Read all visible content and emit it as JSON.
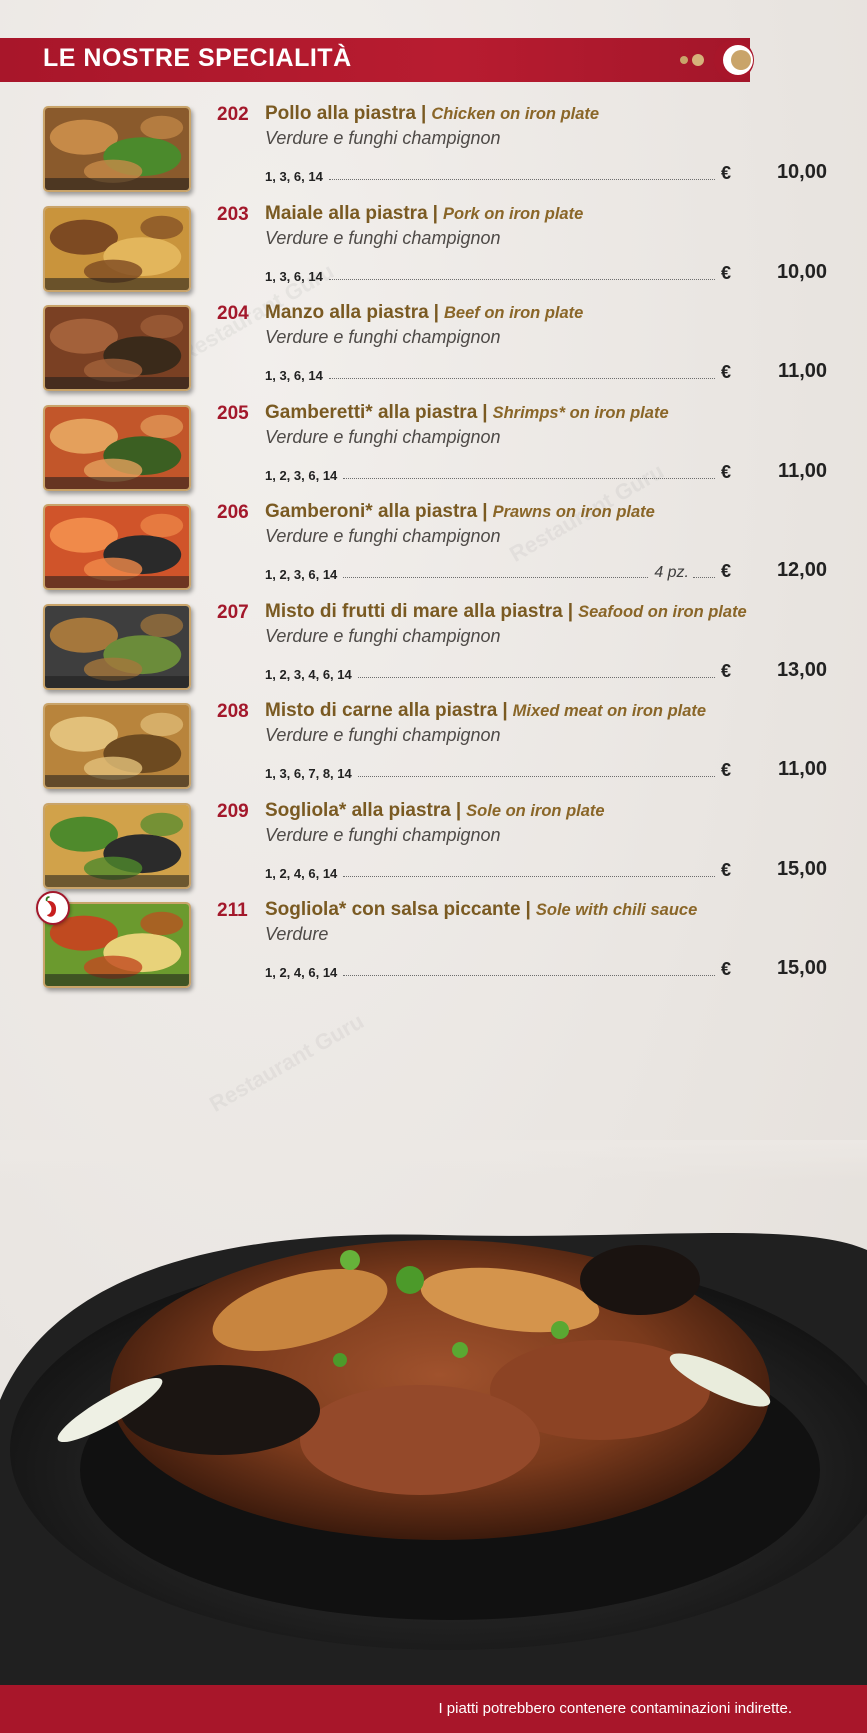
{
  "header": {
    "title": "LE NOSTRE SPECIALITÀ"
  },
  "items": [
    {
      "num": "202",
      "name_it": "Pollo alla piastra",
      "name_en": "Chicken on iron plate",
      "desc": "Verdure e funghi champignon",
      "allergens": "1, 3, 6, 14",
      "qty": "",
      "price": "10,00"
    },
    {
      "num": "203",
      "name_it": "Maiale alla piastra",
      "name_en": "Pork on iron plate",
      "desc": "Verdure e funghi champignon",
      "allergens": "1, 3, 6, 14",
      "qty": "",
      "price": "10,00"
    },
    {
      "num": "204",
      "name_it": "Manzo alla piastra",
      "name_en": "Beef on iron plate",
      "desc": "Verdure e funghi champignon",
      "allergens": "1, 3, 6, 14",
      "qty": "",
      "price": "11,00"
    },
    {
      "num": "205",
      "name_it": "Gamberetti* alla piastra",
      "name_en": "Shrimps* on iron plate",
      "desc": "Verdure e funghi champignon",
      "allergens": "1, 2, 3, 6, 14",
      "qty": "",
      "price": "11,00"
    },
    {
      "num": "206",
      "name_it": "Gamberoni* alla piastra",
      "name_en": "Prawns on iron plate",
      "desc": "Verdure e funghi champignon",
      "allergens": "1, 2, 3, 6, 14",
      "qty": "4 pz.",
      "price": "12,00"
    },
    {
      "num": "207",
      "name_it": "Misto di frutti di mare alla piastra",
      "name_en": "Seafood on iron plate",
      "desc": "Verdure e funghi champignon",
      "allergens": "1, 2, 3, 4, 6, 14",
      "qty": "",
      "price": "13,00"
    },
    {
      "num": "208",
      "name_it": "Misto di carne alla piastra",
      "name_en": "Mixed meat on iron plate",
      "desc": "Verdure e funghi champignon",
      "allergens": "1, 3, 6, 7, 8, 14",
      "qty": "",
      "price": "11,00"
    },
    {
      "num": "209",
      "name_it": "Sogliola* alla piastra",
      "name_en": "Sole on iron plate",
      "desc": "Verdure e funghi champignon",
      "allergens": "1, 2, 4, 6, 14",
      "qty": "",
      "price": "15,00"
    },
    {
      "num": "211",
      "name_it": "Sogliola* con salsa piccante",
      "name_en": "Sole with chili sauce",
      "desc": "Verdure",
      "allergens": "1, 2, 4, 6, 14",
      "qty": "",
      "price": "15,00",
      "spicy": true
    }
  ],
  "currency": "€",
  "separator": "|",
  "footer": {
    "note": "I piatti potrebbero contenere contaminazioni indirette."
  },
  "watermark": "Restaurant Guru",
  "colors": {
    "brand_red": "#a8162a",
    "gold": "#7a5a22"
  }
}
